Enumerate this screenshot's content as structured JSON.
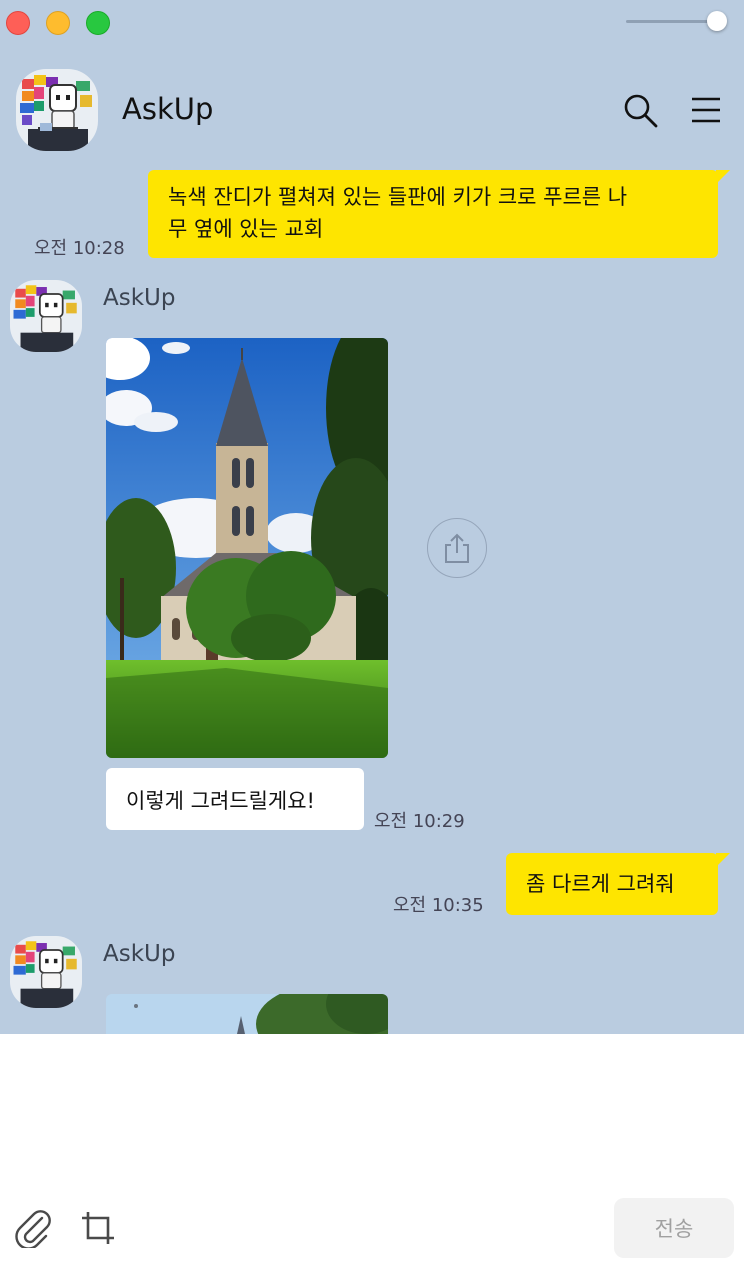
{
  "window": {
    "controls": [
      "close",
      "minimize",
      "maximize"
    ]
  },
  "header": {
    "title": "AskUp",
    "search_icon": "search-icon",
    "menu_icon": "menu-icon"
  },
  "messages": [
    {
      "from": "me",
      "text_line1": "녹색 잔디가 펼쳐져 있는 들판에 키가 크로 푸르른 나",
      "text_line2": "무 옆에 있는 교회",
      "time": "오전 10:28"
    },
    {
      "from": "bot",
      "sender": "AskUp",
      "image": "church-photo",
      "text": "이렇게 그려드릴게요!",
      "time": "오전 10:29"
    },
    {
      "from": "me",
      "text": "좀 다르게 그려줘",
      "time": "오전 10:35"
    },
    {
      "from": "bot",
      "sender": "AskUp",
      "image": "church-photo-2"
    }
  ],
  "composer": {
    "send_label": "전송",
    "attach_icon": "paperclip-icon",
    "capture_icon": "crop-icon"
  },
  "colors": {
    "chat_bg": "#bacce0",
    "my_bubble": "#fee500",
    "bot_bubble": "#ffffff"
  }
}
